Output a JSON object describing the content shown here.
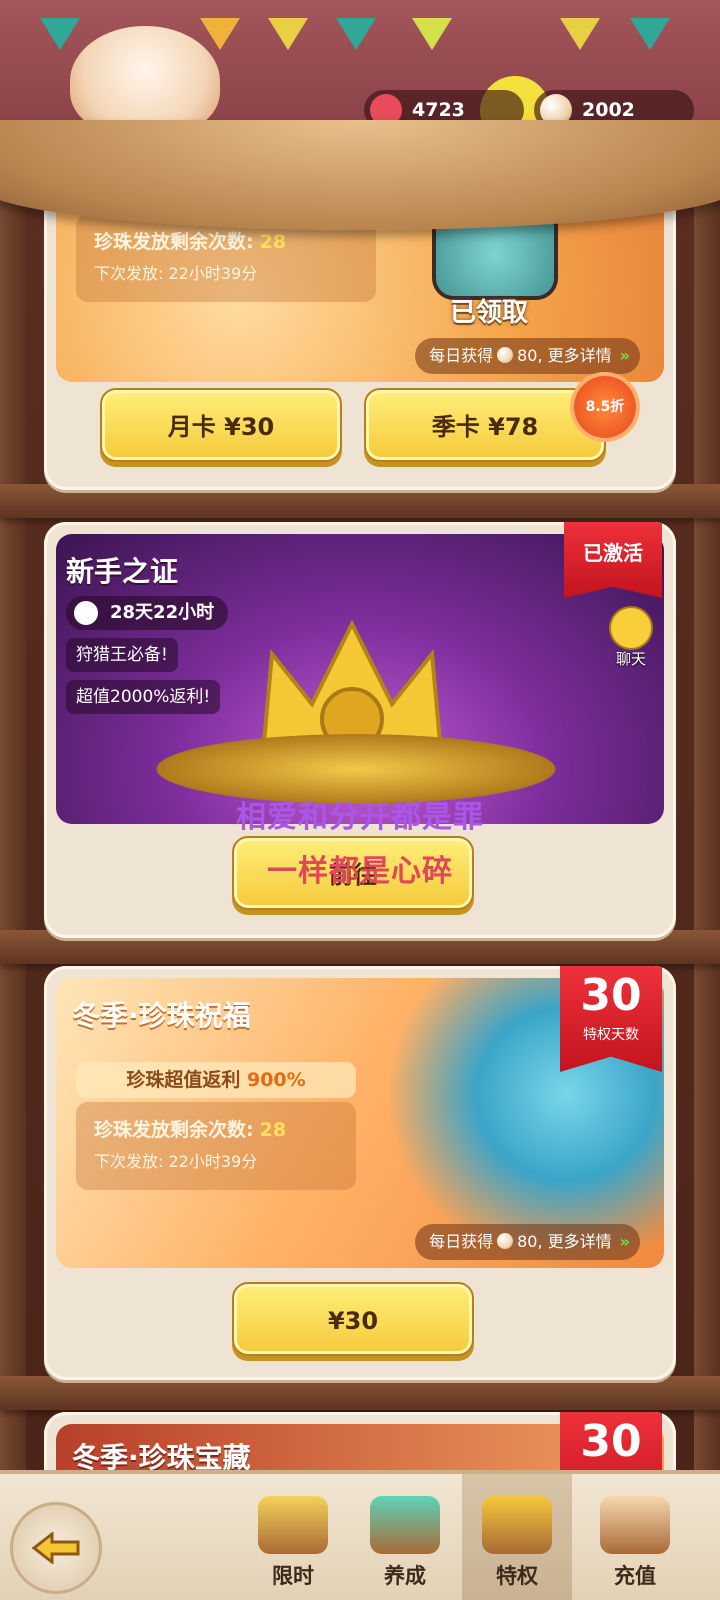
{
  "header": {
    "currency_star": "4723",
    "currency_pearl": "2002"
  },
  "card_monthly": {
    "remaining_label": "珍珠发放剩余次数:",
    "remaining_value": "28",
    "next_label": "下次发放:",
    "next_value": "22小时39分",
    "claimed_label": "已领取",
    "daily_prefix": "每日获得",
    "daily_value": "80,",
    "daily_suffix": "更多详情",
    "btn_month": "月卡 ¥30",
    "btn_season": "季卡 ¥78",
    "discount_badge": "8.5折"
  },
  "card_novice": {
    "title": "新手之证",
    "timer": "28天22小时",
    "line1": "狩猎王必备!",
    "line2": "超值2000%返利!",
    "activated": "已激活",
    "chat_label": "聊天",
    "btn_go": "前往"
  },
  "overlay": {
    "line1": "相爱和分开都是罪",
    "line2": "一样都是心碎"
  },
  "card_winter": {
    "title": "冬季·珍珠祝福",
    "rebate_label": "珍珠超值返利",
    "rebate_value": "900%",
    "remaining_label": "珍珠发放剩余次数:",
    "remaining_value": "28",
    "next_label": "下次发放:",
    "next_value": "22小时39分",
    "ribbon_number": "30",
    "ribbon_label": "特权天数",
    "daily_prefix": "每日获得",
    "daily_value": "80,",
    "daily_suffix": "更多详情",
    "btn_price": "¥30"
  },
  "card_treasure": {
    "title": "冬季·珍珠宝藏",
    "ribbon_number": "30"
  },
  "nav": {
    "items": [
      {
        "label": "限时"
      },
      {
        "label": "养成"
      },
      {
        "label": "特权"
      },
      {
        "label": "充值"
      }
    ],
    "active_index": 2
  }
}
